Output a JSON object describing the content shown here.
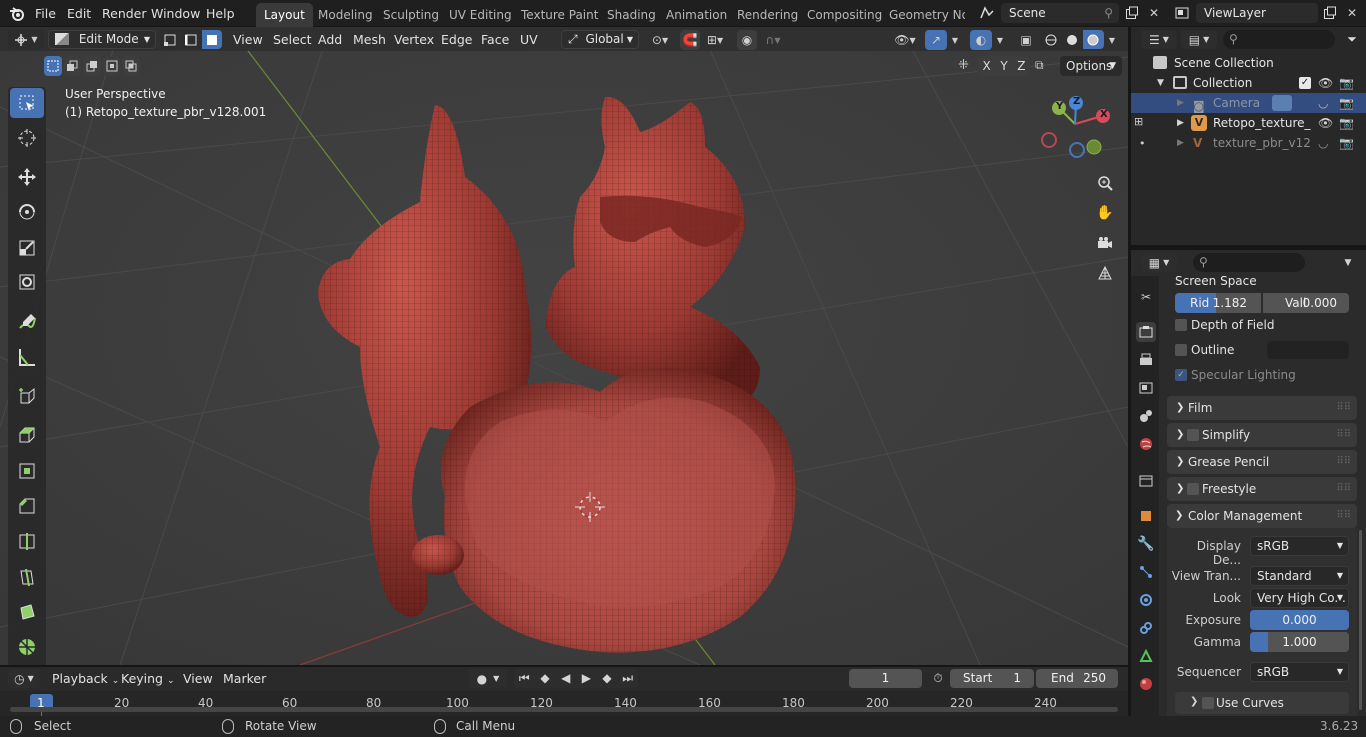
{
  "topbar": {
    "menus": [
      "File",
      "Edit",
      "Render",
      "Window",
      "Help"
    ],
    "workspaces": [
      "Layout",
      "Modeling",
      "Sculpting",
      "UV Editing",
      "Texture Paint",
      "Shading",
      "Animation",
      "Rendering",
      "Compositing",
      "Geometry Noc"
    ],
    "active_workspace": "Layout",
    "scene": "Scene",
    "view_layer": "ViewLayer"
  },
  "viewport_header": {
    "mode": "Edit Mode",
    "menus": [
      "View",
      "Select",
      "Add",
      "Mesh",
      "Vertex",
      "Edge",
      "Face",
      "UV"
    ],
    "orientation": "Global",
    "options": "Options",
    "axes": [
      "X",
      "Y",
      "Z"
    ]
  },
  "viewport": {
    "perspective": "User Perspective",
    "object_label": "(1) Retopo_texture_pbr_v128.001",
    "gizmo": {
      "y": "Y",
      "z": "Z",
      "x": "X"
    }
  },
  "outliner": {
    "root": "Scene Collection",
    "collection": "Collection",
    "items": [
      {
        "name": "Camera",
        "selected": true
      },
      {
        "name": "Retopo_texture_",
        "selected": false
      },
      {
        "name": "texture_pbr_v12",
        "selected": false
      }
    ]
  },
  "properties": {
    "screen_space": "Screen Space",
    "rid_label": "Rid",
    "rid_value": "1.182",
    "vall_label": "Vall",
    "vall_value": "0.000",
    "depth_of_field": "Depth of Field",
    "outline": "Outline",
    "specular_lighting": "Specular Lighting",
    "panels": [
      "Film",
      "Simplify",
      "Grease Pencil",
      "Freestyle"
    ],
    "color_management": "Color Management",
    "display_device_label": "Display De...",
    "display_device_value": "sRGB",
    "view_transform_label": "View Tran...",
    "view_transform_value": "Standard",
    "look_label": "Look",
    "look_value": "Very High Co...",
    "exposure_label": "Exposure",
    "exposure_value": "0.000",
    "gamma_label": "Gamma",
    "gamma_value": "1.000",
    "sequencer_label": "Sequencer",
    "sequencer_value": "sRGB",
    "use_curves": "Use Curves"
  },
  "timeline": {
    "menus": [
      "Playback",
      "Keying",
      "View",
      "Marker"
    ],
    "current_frame": "1",
    "start_label": "Start",
    "start": "1",
    "end_label": "End",
    "end": "250",
    "ticks": [
      "1",
      "20",
      "40",
      "60",
      "80",
      "100",
      "120",
      "140",
      "160",
      "180",
      "200",
      "220",
      "240"
    ]
  },
  "statusbar": {
    "select": "Select",
    "rotate": "Rotate View",
    "call_menu": "Call Menu",
    "version": "3.6.23"
  },
  "colors": {
    "accent": "#4772b3",
    "model": "#a8413a",
    "background": "#3d3d3d"
  }
}
